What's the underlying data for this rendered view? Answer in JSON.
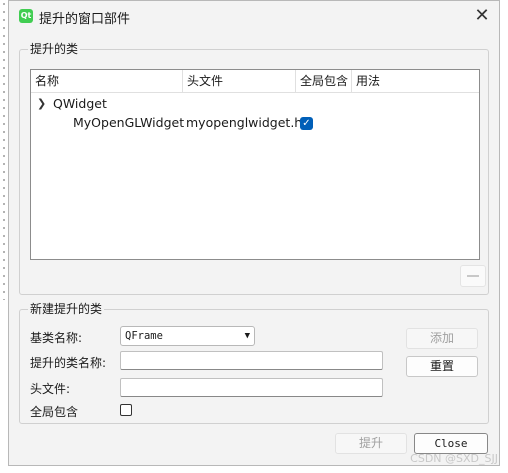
{
  "window": {
    "title": "提升的窗口部件",
    "icon": "qt-logo-icon"
  },
  "promoted_group": {
    "title": "提升的类",
    "columns": [
      "名称",
      "头文件",
      "全局包含",
      "用法"
    ],
    "rows": [
      {
        "name": "QWidget",
        "expanded": true
      },
      {
        "name": "MyOpenGLWidget",
        "header": "myopenglwidget.h",
        "global_include": true
      }
    ]
  },
  "new_group": {
    "title": "新建提升的类",
    "base_class_label": "基类名称:",
    "base_class_value": "QFrame",
    "promoted_name_label": "提升的类名称:",
    "promoted_name_value": "",
    "header_label": "头文件:",
    "header_value": "",
    "global_include_label": "全局包含",
    "add_button": "添加",
    "reset_button": "重置"
  },
  "footer": {
    "promote_button": "提升",
    "close_button": "Close"
  },
  "watermark": "CSDN @SXD_SJJ",
  "colors": {
    "accent": "#005fb8",
    "qt_green": "#41cd52"
  }
}
